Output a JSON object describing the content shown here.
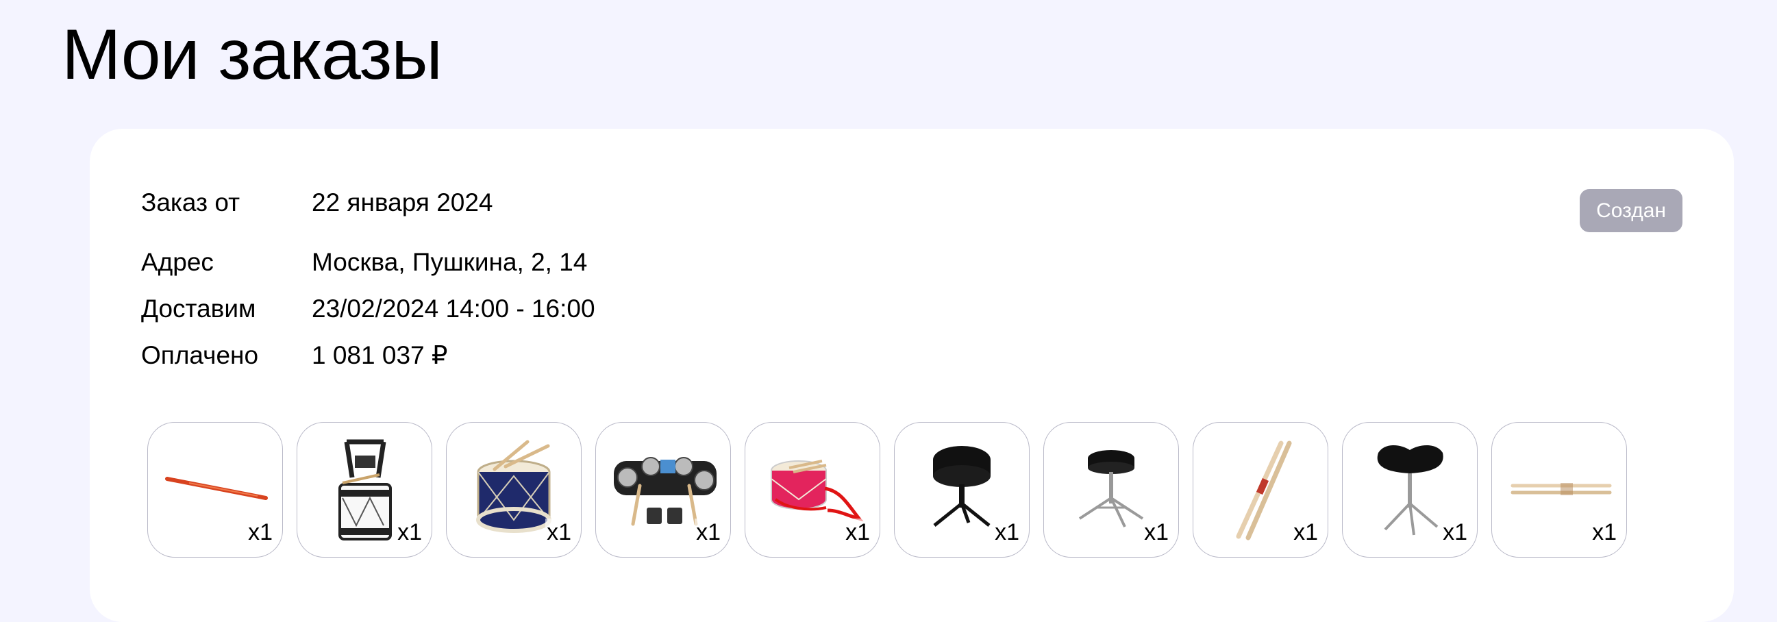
{
  "page": {
    "title": "Мои заказы"
  },
  "order": {
    "date_label": "Заказ от",
    "date_value": "22 января 2024",
    "address_label": "Адрес",
    "address_value": "Москва, Пушкина, 2, 14",
    "delivery_label": "Доставим",
    "delivery_value": "23/02/2024 14:00 - 16:00",
    "paid_label": "Оплачено",
    "paid_value": "1 081 037 ₽",
    "status": "Создан",
    "items": [
      {
        "icon": "drumstick-red-icon",
        "qty": "x1"
      },
      {
        "icon": "marching-drum-harness-icon",
        "qty": "x1"
      },
      {
        "icon": "tenor-drum-blue-icon",
        "qty": "x1"
      },
      {
        "icon": "electronic-drum-pad-icon",
        "qty": "x1"
      },
      {
        "icon": "toy-drum-pink-icon",
        "qty": "x1"
      },
      {
        "icon": "drum-throne-round-icon",
        "qty": "x1"
      },
      {
        "icon": "drum-throne-chrome-icon",
        "qty": "x1"
      },
      {
        "icon": "drumsticks-wood-icon",
        "qty": "x1"
      },
      {
        "icon": "drum-throne-saddle-icon",
        "qty": "x1"
      },
      {
        "icon": "drumsticks-pair-icon",
        "qty": "x1"
      }
    ]
  },
  "colors": {
    "page_background": "#f4f4ff",
    "card_background": "#ffffff",
    "status_badge": "#a9a8b6",
    "tile_border": "#b9b9c8"
  }
}
